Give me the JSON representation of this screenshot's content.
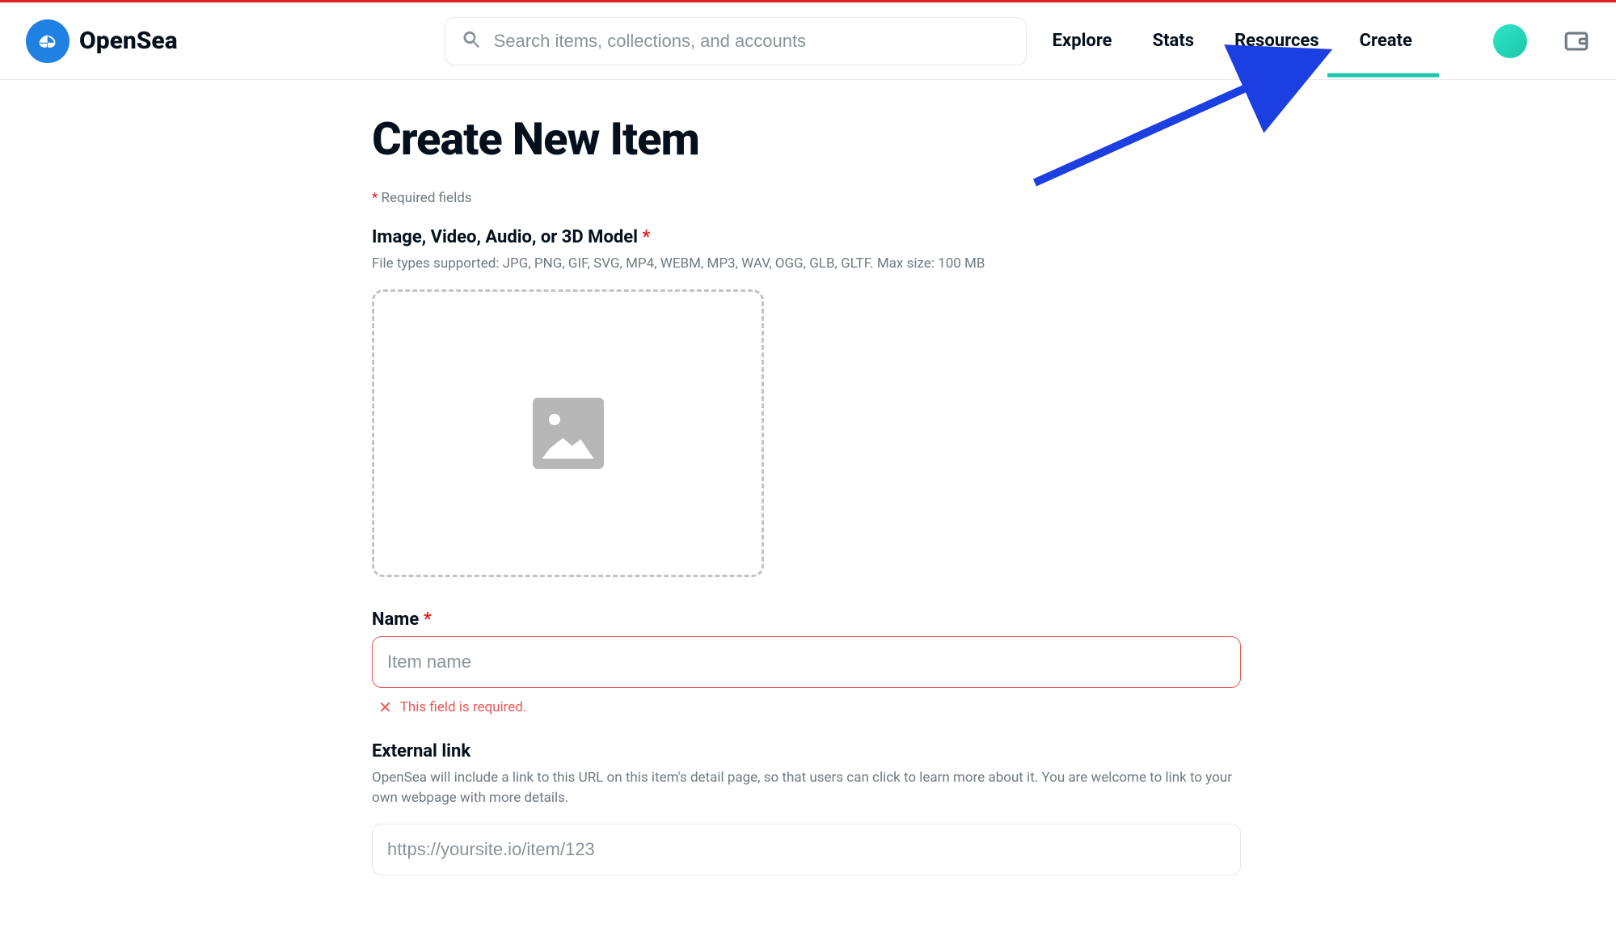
{
  "brand": "OpenSea",
  "search": {
    "placeholder": "Search items, collections, and accounts"
  },
  "nav": {
    "explore": "Explore",
    "stats": "Stats",
    "resources": "Resources",
    "create": "Create"
  },
  "page": {
    "title": "Create New Item",
    "required_note": "Required fields"
  },
  "upload": {
    "label": "Image, Video, Audio, or 3D Model",
    "help": "File types supported: JPG, PNG, GIF, SVG, MP4, WEBM, MP3, WAV, OGG, GLB, GLTF. Max size: 100 MB"
  },
  "name_field": {
    "label": "Name",
    "placeholder": "Item name",
    "error": "This field is required."
  },
  "external_link": {
    "label": "External link",
    "help": "OpenSea will include a link to this URL on this item's detail page, so that users can click to learn more about it. You are welcome to link to your own webpage with more details.",
    "placeholder": "https://yoursite.io/item/123"
  }
}
